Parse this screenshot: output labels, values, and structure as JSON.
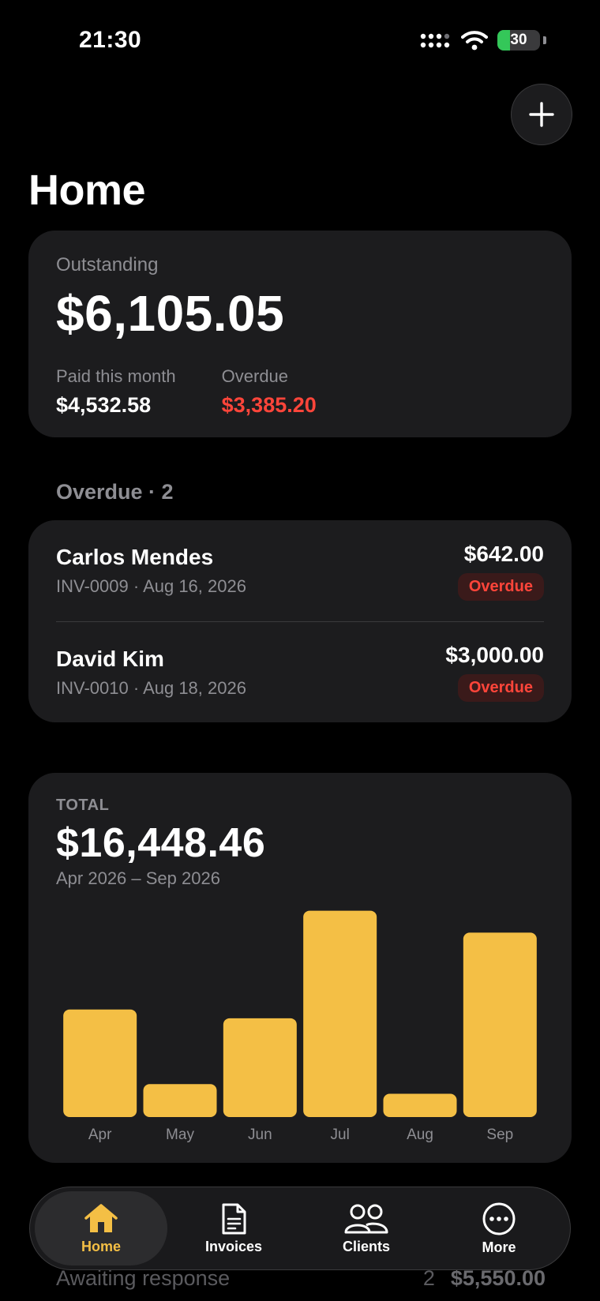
{
  "status": {
    "time": "21:30",
    "battery": "30"
  },
  "header": {
    "title": "Home"
  },
  "summary": {
    "outstanding_label": "Outstanding",
    "outstanding_value": "$6,105.05",
    "paid_label": "Paid this month",
    "paid_value": "$4,532.58",
    "overdue_label": "Overdue",
    "overdue_value": "$3,385.20"
  },
  "overdue_section": {
    "title": "Overdue · 2",
    "items": [
      {
        "name": "Carlos Mendes",
        "meta": "INV-0009 · Aug 16, 2026",
        "amount": "$642.00",
        "status": "Overdue"
      },
      {
        "name": "David Kim",
        "meta": "INV-0010 · Aug 18, 2026",
        "amount": "$3,000.00",
        "status": "Overdue"
      }
    ]
  },
  "chart_card": {
    "kicker": "TOTAL",
    "total": "$16,448.46",
    "range": "Apr 2026 – Sep 2026"
  },
  "chart_data": {
    "type": "bar",
    "categories": [
      "Apr",
      "May",
      "Jun",
      "Jul",
      "Aug",
      "Sep"
    ],
    "values": [
      2450,
      750,
      2250,
      4700,
      530,
      4200
    ],
    "ylim": [
      0,
      4800
    ],
    "bar_color": "#F4BF45",
    "grid": false
  },
  "peek": {
    "label": "Awaiting response",
    "count": "2",
    "amount": "$5,550.00"
  },
  "tabs": [
    {
      "label": "Home",
      "icon": "house-icon",
      "active": true
    },
    {
      "label": "Invoices",
      "icon": "document-icon",
      "active": false
    },
    {
      "label": "Clients",
      "icon": "people-icon",
      "active": false
    },
    {
      "label": "More",
      "icon": "ellipsis-circle-icon",
      "active": false
    }
  ],
  "colors": {
    "accent": "#F4BF45",
    "danger": "#FF453A",
    "card": "#1C1C1E",
    "background": "#000000"
  }
}
